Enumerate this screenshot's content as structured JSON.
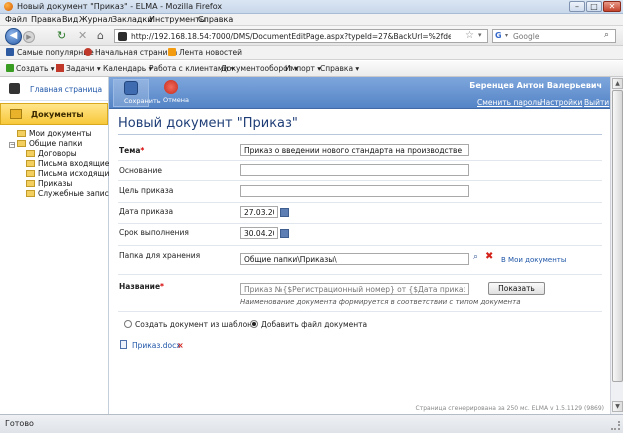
{
  "window": {
    "title": "Новый документ \"Приказ\" - ELMA - Mozilla Firefox",
    "minimize": "–",
    "maximize": "□",
    "close": "✕"
  },
  "menubar": [
    "Файл",
    "Правка",
    "Вид",
    "Журнал",
    "Закладки",
    "Инструменты",
    "Справка"
  ],
  "navbar": {
    "url": "http://192.168.18.54:7000/DMS/DocumentEditPage.aspx?typeId=27&BackUrl=%2fdefault.aspx",
    "search_placeholder": "Google",
    "back": "◀",
    "forward": "▶",
    "reload": "↻",
    "stop": "✕",
    "home": "⌂",
    "star": "☆",
    "dropdown": "▾",
    "search_engine_letter": "G",
    "search_glyph": "⌕"
  },
  "bookmarks": [
    {
      "label": "Самые популярные",
      "color": "#2d5aa0"
    },
    {
      "label": "Начальная страница",
      "color": "#c0392b"
    },
    {
      "label": "Лента новостей",
      "color": "#f39c12"
    }
  ],
  "app_toolbar": [
    {
      "label": "Создать ▾",
      "color": "#3a9d23"
    },
    {
      "label": "Задачи ▾",
      "color": "#c0392b"
    },
    {
      "label": "Календарь ▾",
      "color": ""
    },
    {
      "label": "Работа с клиентами ▾",
      "color": ""
    },
    {
      "label": "Документооборот ▾",
      "color": ""
    },
    {
      "label": "Импорт ▾",
      "color": ""
    },
    {
      "label": "Справка ▾",
      "color": ""
    }
  ],
  "sidebar": {
    "home": "Главная страница",
    "docs": "Документы",
    "tree": [
      {
        "label": "Мои документы",
        "level": 0
      },
      {
        "label": "Общие папки",
        "level": 0,
        "expanded": true
      },
      {
        "label": "Договоры",
        "level": 1
      },
      {
        "label": "Письма входящие",
        "level": 1
      },
      {
        "label": "Письма исходящие",
        "level": 1
      },
      {
        "label": "Приказы",
        "level": 1
      },
      {
        "label": "Служебные записки",
        "level": 1
      }
    ],
    "collapse_glyph": "−"
  },
  "header": {
    "save": "Сохранить",
    "cancel": "Отмена",
    "user": "Беренцев Антон Валерьевич",
    "change_password": "Сменить пароль",
    "settings": "Настройки",
    "logout": "Выйти"
  },
  "form": {
    "title": "Новый документ \"Приказ\"",
    "subject_label": "Тема",
    "required_mark": "*",
    "subject_value": "Приказ о введении нового стандарта на производстве",
    "basis_label": "Основание",
    "basis_value": "",
    "purpose_label": "Цель приказа",
    "purpose_value": "",
    "order_date_label": "Дата приказа",
    "order_date_value": "27.03.2009",
    "due_date_label": "Срок выполнения",
    "due_date_value": "30.04.2009",
    "folder_label": "Папка для хранения",
    "folder_value": "Общие папки\\Приказы\\",
    "my_docs_link": "В Мои документы",
    "name_label": "Название",
    "name_placeholder": "Приказ №{$Регистрационный номер} от {$Дата приказа.Кор",
    "show_button": "Показать",
    "name_hint": "Наименование документа формируется в соответствии с типом документа",
    "radio_template": "Создать документ из шаблона",
    "radio_file": "Добавить файл документа",
    "file_name": "Приказ.docx",
    "file_delete": "×",
    "clear_glyph": "✖",
    "search_glyph": "⌕"
  },
  "footer_text": "Страница сгенерирована за 250 мс. ELMA v 1.5.1129 (9869)",
  "scroll": {
    "up": "▲",
    "down": "▼"
  },
  "status": "Готово"
}
